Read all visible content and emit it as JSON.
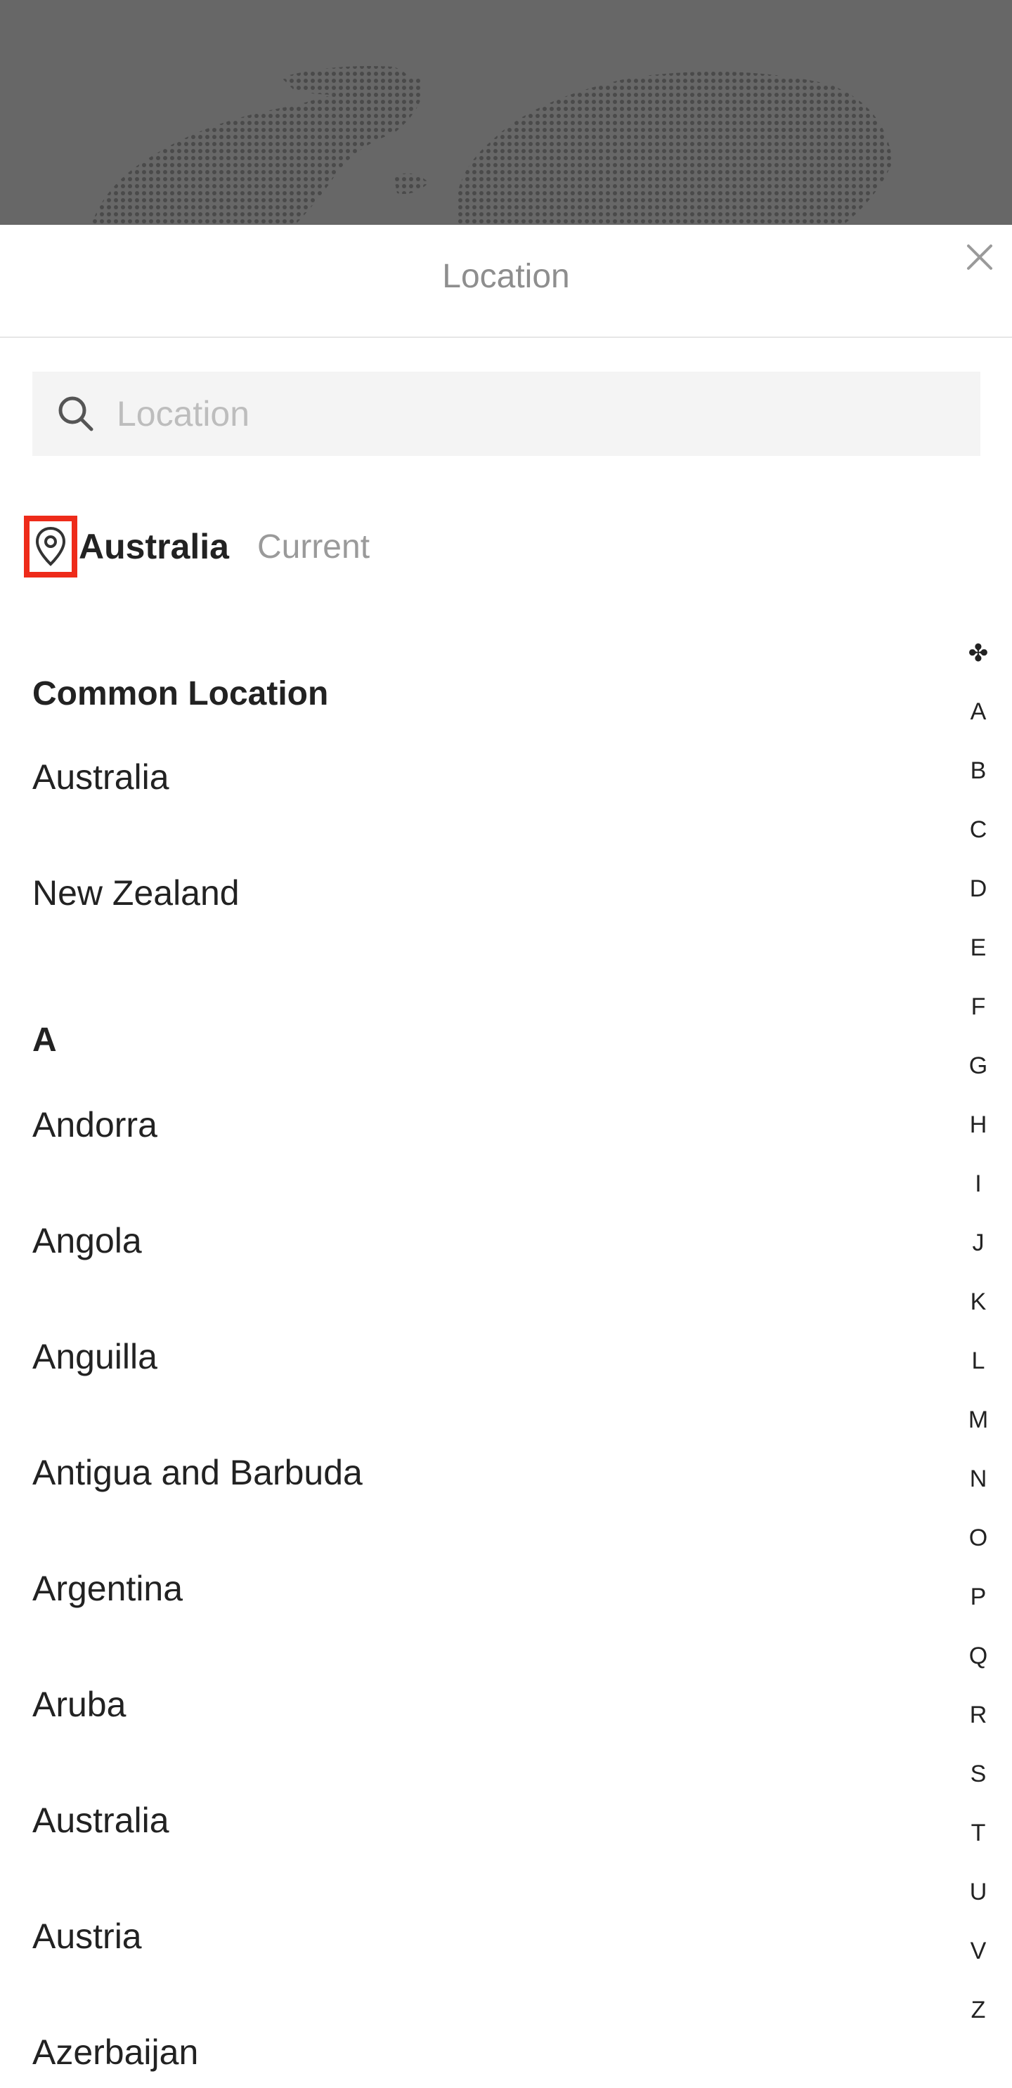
{
  "header": {
    "title": "Location"
  },
  "search": {
    "placeholder": "Location"
  },
  "current": {
    "name": "Australia",
    "tag": "Current"
  },
  "common": {
    "title": "Common Location",
    "items": [
      "Australia",
      "New Zealand"
    ]
  },
  "section_a": {
    "title": "A",
    "items": [
      "Andorra",
      "Angola",
      "Anguilla",
      "Antigua and Barbuda",
      "Argentina",
      "Aruba",
      "Australia",
      "Austria",
      "Azerbaijan"
    ]
  },
  "index": {
    "symbol": "✤",
    "letters": [
      "A",
      "B",
      "C",
      "D",
      "E",
      "F",
      "G",
      "H",
      "I",
      "J",
      "K",
      "L",
      "M",
      "N",
      "O",
      "P",
      "Q",
      "R",
      "S",
      "T",
      "U",
      "V",
      "Z"
    ]
  },
  "colors": {
    "backdrop": "#676767",
    "highlight": "#ee2b1a",
    "text": "#222222",
    "muted": "#8e8e8e"
  },
  "icons": [
    "close-icon",
    "search-icon",
    "location-pin-icon",
    "index-star-icon"
  ]
}
